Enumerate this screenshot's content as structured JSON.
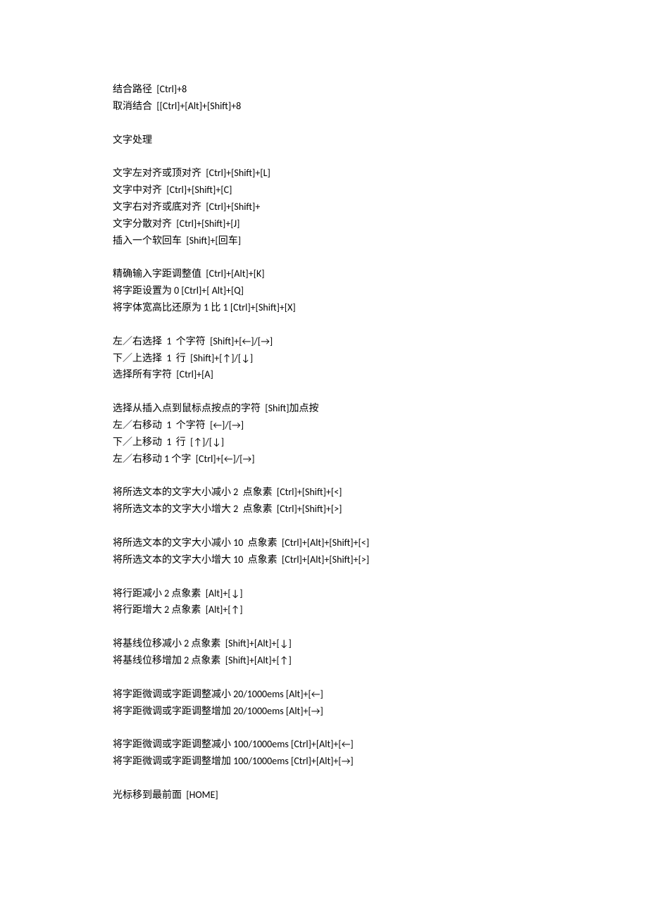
{
  "blocks": [
    [
      "结合路径  [Ctrl]+8",
      "取消结合  [[Ctrl]+[Alt]+[Shift]+8"
    ],
    [
      "文字处理"
    ],
    [
      "文字左对齐或顶对齐  [Ctrl]+[Shift]+[L]",
      "文字中对齐  [Ctrl]+[Shift]+[C]",
      "文字右对齐或底对齐  [Ctrl]+[Shift]+",
      "文字分散对齐  [Ctrl]+[Shift]+[J]",
      "插入一个软回车  [Shift]+[回车]"
    ],
    [
      "精确输入字距调整值  [Ctrl]+[Alt]+[K]",
      "将字距设置为 0 [Ctrl]+[ Alt]+[Q]",
      "将字体宽高比还原为 1 比 1 [Ctrl]+[Shift]+[X]"
    ],
    [
      "左／右选择  1  个字符  [Shift]+[←]/[→]",
      "下／上选择  1  行  [Shift]+[↑]/[↓]",
      "选择所有字符  [Ctrl]+[A]"
    ],
    [
      "选择从插入点到鼠标点按点的字符  [Shift]加点按",
      "左／右移动  1  个字符  [←]/[→]",
      "下／上移动  1  行  [↑]/[↓]",
      "左／右移动 1 个字  [Ctrl]+[←]/[→]"
    ],
    [
      "将所选文本的文字大小减小 2  点象素  [Ctrl]+[Shift]+[<]",
      "将所选文本的文字大小增大 2  点象素  [Ctrl]+[Shift]+[>]"
    ],
    [
      "将所选文本的文字大小减小 10  点象素  [Ctrl]+[Alt]+[Shift]+[<]",
      "将所选文本的文字大小增大 10  点象素  [Ctrl]+[Alt]+[Shift]+[>]"
    ],
    [
      "将行距减小 2 点象素  [Alt]+[↓]",
      "将行距增大 2 点象素  [Alt]+[↑]"
    ],
    [
      "将基线位移减小 2 点象素  [Shift]+[Alt]+[↓]",
      "将基线位移增加 2 点象素  [Shift]+[Alt]+[↑]"
    ],
    [
      "将字距微调或字距调整减小 20/1000ems [Alt]+[←]",
      "将字距微调或字距调整增加 20/1000ems [Alt]+[→]"
    ],
    [
      "将字距微调或字距调整减小 100/1000ems [Ctrl]+[Alt]+[←]",
      "将字距微调或字距调整增加 100/1000ems [Ctrl]+[Alt]+[→]"
    ],
    [
      "光标移到最前面  [HOME]"
    ]
  ]
}
